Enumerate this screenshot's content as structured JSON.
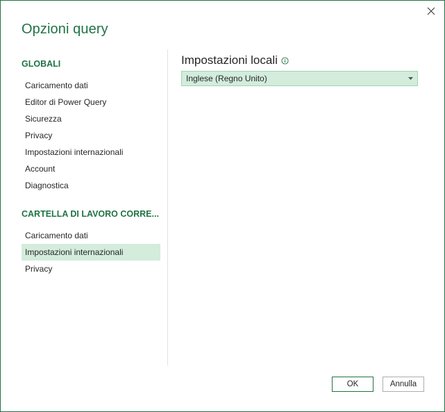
{
  "dialog": {
    "title": "Opzioni query",
    "close_glyph": "✕"
  },
  "sidebar": {
    "globals_header": "GLOBALI",
    "globals_items": [
      {
        "label": "Caricamento dati"
      },
      {
        "label": "Editor di Power Query"
      },
      {
        "label": "Sicurezza"
      },
      {
        "label": "Privacy"
      },
      {
        "label": "Impostazioni internazionali"
      },
      {
        "label": "Account"
      },
      {
        "label": "Diagnostica"
      }
    ],
    "workbook_header": "CARTELLA DI LAVORO CORRE...",
    "workbook_items": [
      {
        "label": "Caricamento dati"
      },
      {
        "label": "Impostazioni internazionali",
        "selected": true
      },
      {
        "label": "Privacy"
      }
    ]
  },
  "content": {
    "title": "Impostazioni locali",
    "info_icon": "info-icon",
    "locale_dropdown": {
      "value": "Inglese (Regno Unito)"
    }
  },
  "buttons": {
    "ok_label": "OK",
    "cancel_label": "Annulla"
  },
  "colors": {
    "accent": "#217346",
    "selected_bg": "#d3ecdc"
  }
}
